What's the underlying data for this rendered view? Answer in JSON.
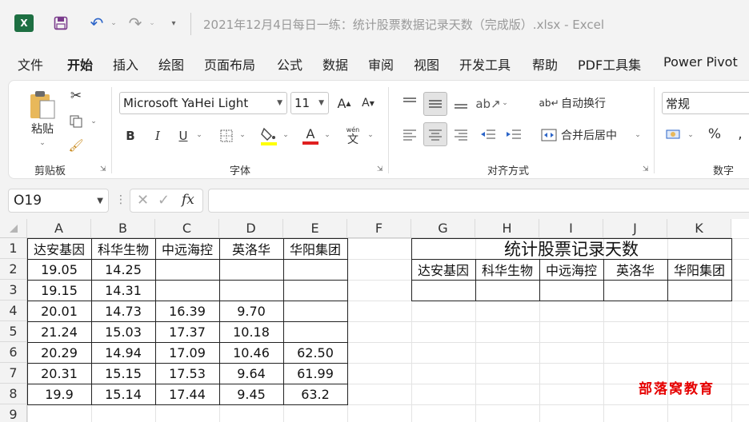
{
  "title_bar": {
    "title": "2021年12月4日每日一练：统计股票数据记录天数（完成版）.xlsx  -  Excel",
    "app_icon_letter": "X"
  },
  "menu": [
    "文件",
    "开始",
    "插入",
    "绘图",
    "页面布局",
    "公式",
    "数据",
    "审阅",
    "视图",
    "开发工具",
    "帮助",
    "PDF工具集",
    "Power Pivot"
  ],
  "active_menu": "开始",
  "ribbon": {
    "clipboard": {
      "paste_label": "粘贴",
      "group_label": "剪贴板"
    },
    "font": {
      "font_name": "Microsoft YaHei Light",
      "font_size": "11",
      "bold": "B",
      "italic": "I",
      "underline": "U",
      "font_color_letter": "A",
      "grow": "A",
      "shrink": "A",
      "pinyin_top": "wén",
      "pinyin_char": "文",
      "group_label": "字体"
    },
    "alignment": {
      "wrap_text": "自动换行",
      "merge_center": "合并后居中",
      "group_label": "对齐方式"
    },
    "number": {
      "format": "常规",
      "percent": "%",
      "group_label": "数字"
    },
    "highlight_color": "#ffff00",
    "font_color": "#e02020"
  },
  "formula_bar": {
    "name_box": "O19",
    "fx": "fx",
    "formula": ""
  },
  "sheet": {
    "columns": [
      "A",
      "B",
      "C",
      "D",
      "E",
      "F",
      "G",
      "H",
      "I",
      "J",
      "K"
    ],
    "rows": [
      "1",
      "2",
      "3",
      "4",
      "5",
      "6",
      "7",
      "8",
      "9"
    ],
    "data_headers": [
      "达安基因",
      "科华生物",
      "中远海控",
      "英洛华",
      "华阳集团"
    ],
    "data_rows": [
      [
        "19.05",
        "14.25",
        "",
        "",
        ""
      ],
      [
        "19.15",
        "14.31",
        "",
        "",
        ""
      ],
      [
        "20.01",
        "14.73",
        "16.39",
        "9.70",
        ""
      ],
      [
        "21.24",
        "15.03",
        "17.37",
        "10.18",
        ""
      ],
      [
        "20.29",
        "14.94",
        "17.09",
        "10.46",
        "62.50"
      ],
      [
        "20.31",
        "15.15",
        "17.53",
        "9.64",
        "61.99"
      ],
      [
        "19.9",
        "15.14",
        "17.44",
        "9.45",
        "63.2"
      ]
    ],
    "summary_title": "统计股票记录天数",
    "summary_headers": [
      "达安基因",
      "科华生物",
      "中远海控",
      "英洛华",
      "华阳集团"
    ],
    "summary_values": [
      "",
      "",
      "",
      "",
      ""
    ]
  },
  "watermark": "部落窝教育"
}
